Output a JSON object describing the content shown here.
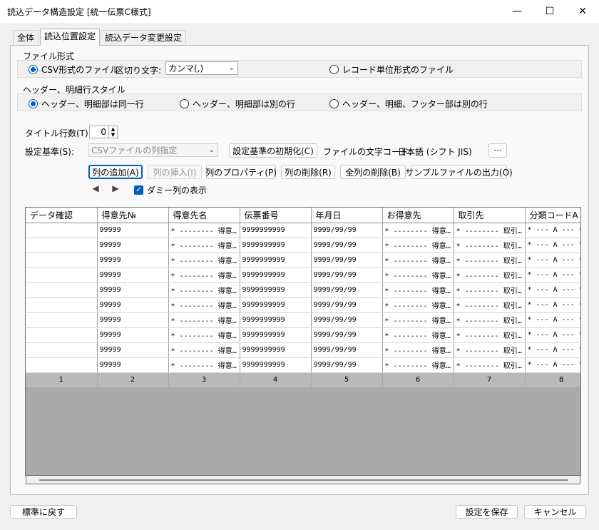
{
  "window": {
    "title": "読込データ構造設定 [統一伝票C様式]",
    "minimize_glyph": "—",
    "maximize_glyph": "☐",
    "close_glyph": "✕"
  },
  "tabs": [
    {
      "label": "全体"
    },
    {
      "label": "読込位置設定"
    },
    {
      "label": "読込データ変更設定"
    }
  ],
  "file_format": {
    "group_label": "ファイル形式",
    "csv_label": "CSV形式のファイル",
    "delimiter_label": "区切り文字:",
    "delimiter_value": "カンマ(,)",
    "record_label": "レコード単位形式のファイル",
    "selected": "csv"
  },
  "header_style": {
    "group_label": "ヘッダー、明細行スタイル",
    "options": [
      "ヘッダー、明細部は同一行",
      "ヘッダー、明細部は別の行",
      "ヘッダー、明細、フッター部は別の行"
    ],
    "selected_index": 0
  },
  "title_rows": {
    "label": "タイトル行数(T):",
    "value": "0"
  },
  "setting_basis": {
    "label": "設定基準(S):",
    "value": "CSVファイルの列指定",
    "reset_button": "設定基準の初期化(C)",
    "encoding_label": "ファイルの文字コード:",
    "encoding_value": "日本語 (シフト JIS)",
    "more_button": "···"
  },
  "toolbar": {
    "add_column": "列の追加(A)",
    "insert_column": "列の挿入(I)",
    "column_properties": "列のプロパティ(P)",
    "delete_column": "列の削除(R)",
    "delete_all_columns": "全列の削除(B)",
    "output_sample": "サンプルファイルの出力(O)"
  },
  "dummy_column": {
    "label": "ダミー列の表示",
    "checked": true
  },
  "grid": {
    "headers": [
      "データ確認",
      "得意先№",
      "得意先名",
      "伝票番号",
      "年月日",
      "お得意先",
      "取引先",
      "分類コードA"
    ],
    "row_template": [
      "",
      "99999",
      "* -------- 得意…",
      "9999999999",
      "9999/99/99",
      "* -------- 得意…",
      "* -------- 取引…",
      "* --- A --- *"
    ],
    "row_count": 10,
    "column_numbers": [
      "1",
      "2",
      "3",
      "4",
      "5",
      "6",
      "7",
      "8"
    ]
  },
  "footer": {
    "reset_default": "標準に戻す",
    "save": "設定を保存",
    "cancel": "キャンセル"
  },
  "colors": {
    "accent": "#005fb8"
  }
}
